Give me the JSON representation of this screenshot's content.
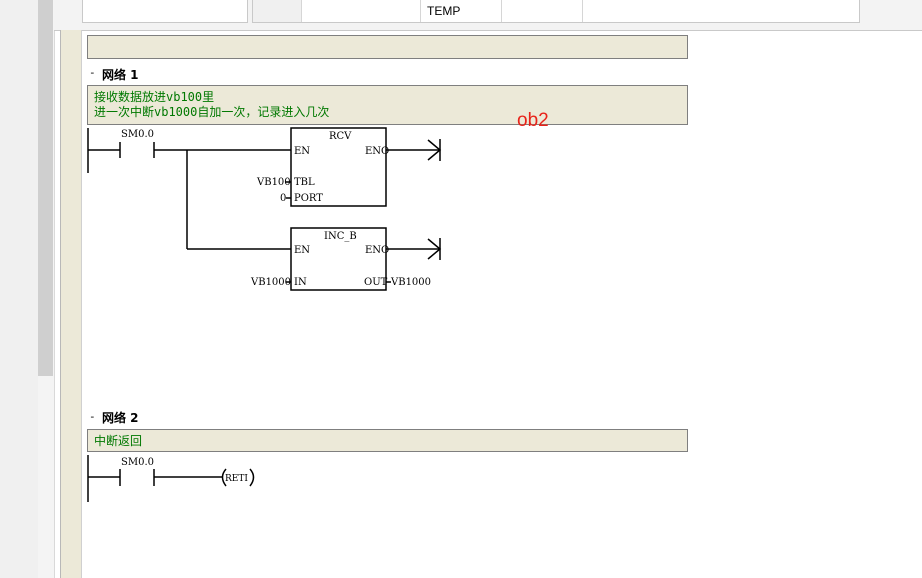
{
  "var_table": {
    "temp_label": "TEMP"
  },
  "networks": [
    {
      "title": "网络 1",
      "comment_line1": "接收数据放进vb100里",
      "comment_line2": "进一次中断vb1000自加一次，记录进入几次",
      "contact": "SM0.0",
      "rcv": {
        "name": "RCV",
        "en": "EN",
        "eno": "ENO",
        "tbl": "TBL",
        "port": "PORT",
        "tbl_in": "VB100",
        "port_in": "0"
      },
      "inc": {
        "name": "INC_B",
        "en": "EN",
        "eno": "ENO",
        "in": "IN",
        "out": "OUT",
        "in_val": "VB1000",
        "out_val": "VB1000"
      }
    },
    {
      "title": "网络 2",
      "comment_line1": "中断返回",
      "contact": "SM0.0",
      "coil": "RETI"
    }
  ],
  "annotation": "ob2",
  "collapse_glyph": "-"
}
